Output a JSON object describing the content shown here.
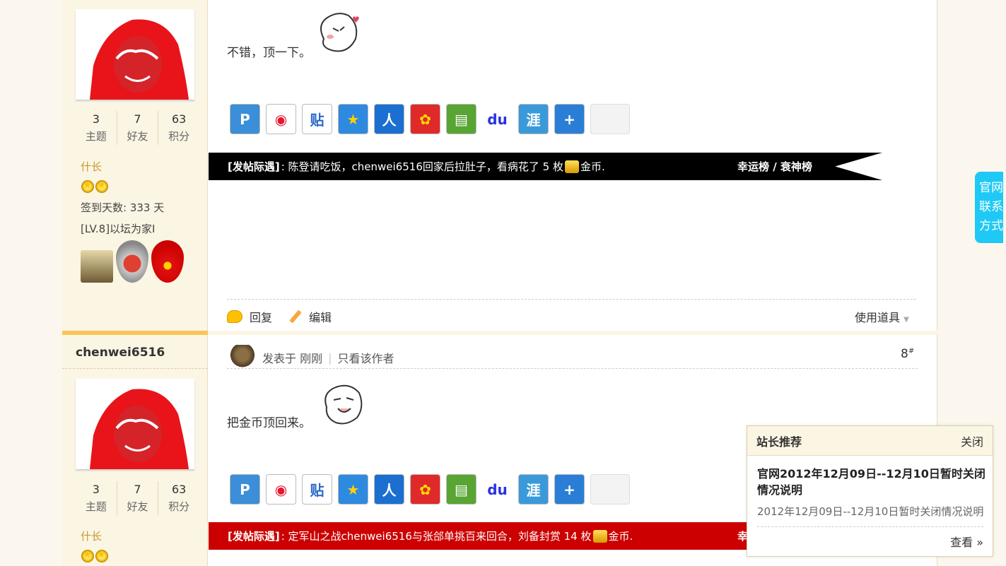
{
  "post1": {
    "text": "不错，顶一下。",
    "author_stats": [
      {
        "num": "3",
        "label": "主题"
      },
      {
        "num": "7",
        "label": "好友"
      },
      {
        "num": "63",
        "label": "积分"
      }
    ],
    "rank": "什长",
    "signin": "签到天数: 333 天",
    "level": "[LV.8]以坛为家I",
    "banner": {
      "tag": "[发帖际遇]",
      "text": ": 陈登请吃饭，chenwei6516回家后拉肚子，看病花了 5 枚 ",
      "currency": "金币.",
      "right": "幸运榜 / 衰神榜",
      "bg": "#000000"
    },
    "actions": {
      "reply": "回复",
      "edit": "编辑",
      "tools": "使用道具"
    }
  },
  "post2": {
    "username": "chenwei6516",
    "posted": "发表于 刚刚",
    "only_author": "只看该作者",
    "floor": "8",
    "floor_sup": "#",
    "text": "把金币顶回来。",
    "author_stats": [
      {
        "num": "3",
        "label": "主题"
      },
      {
        "num": "7",
        "label": "好友"
      },
      {
        "num": "63",
        "label": "积分"
      }
    ],
    "rank": "什长",
    "banner": {
      "tag": "[发帖际遇]",
      "text": ": 定军山之战chenwei6516与张郃单挑百来回合，刘备封赏 14 枚 ",
      "currency": "金币.",
      "right": "幸",
      "bg": "#cc0000"
    }
  },
  "share_icons": [
    "qzone-icon",
    "weibo-icon",
    "tieba-icon",
    "qq-space-icon",
    "renren-icon",
    "kaixin-icon",
    "pengyou-icon",
    "baidu-icon",
    "huijia-icon",
    "more-share-icon",
    "share-blank"
  ],
  "right_tab": {
    "line1": "官网",
    "line2": "联系",
    "line3": "方式"
  },
  "popup": {
    "header": "站长推荐",
    "close": "关闭",
    "title": "官网2012年12月09日--12月10日暂时关闭情况说明",
    "subtitle": "2012年12月09日--12月10日暂时关闭情况说明",
    "more": "查看 »"
  }
}
